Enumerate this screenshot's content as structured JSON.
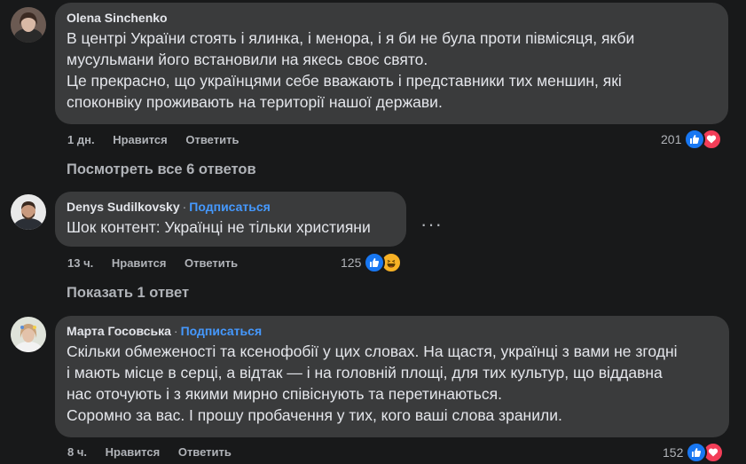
{
  "comments": [
    {
      "author": "Olena Sinchenko",
      "follow": "",
      "lines": [
        "В центрі України стоять і ялинка, і менора, і я би не була проти півмісяця, якби",
        "мусульмани його встановили на якесь своє свято.",
        "Це прекрасно, що українцями себе вважають і представники тих меншин, які",
        "споконвіку проживають на території нашої держави."
      ],
      "time": "1 дн.",
      "like_label": "Нравится",
      "reply_label": "Ответить",
      "reaction_count": "201",
      "reactions": [
        "like-icon",
        "love-icon"
      ]
    },
    {
      "author": "Denys Sudilkovsky",
      "follow": "Подписаться",
      "lines": [
        "Шок контент: Українці не тільки християни"
      ],
      "time": "13 ч.",
      "like_label": "Нравится",
      "reply_label": "Ответить",
      "reaction_count": "125",
      "reactions": [
        "like-icon",
        "haha-icon"
      ]
    },
    {
      "author": "Марта Госовська",
      "follow": "Подписаться",
      "lines": [
        "Скільки обмеженості та ксенофобії у цих словах. На щастя, українці з вами не згодні",
        "і мають місце в серці, а відтак — і на головній площі, для тих культур, що віддавна",
        "нас оточують і з якими мирно співіснують та перетинаються.",
        "Соромно за вас. І прошу пробачення у тих, кого ваші слова зранили."
      ],
      "time": "8 ч.",
      "like_label": "Нравится",
      "reply_label": "Ответить",
      "reaction_count": "152",
      "reactions": [
        "like-icon",
        "love-icon"
      ]
    }
  ],
  "view_replies_1": "Посмотреть все 6 ответов",
  "view_replies_2": "Показать 1 ответ",
  "more_options": "···",
  "colors": {
    "background": "#18191a",
    "bubble": "#3a3b3c",
    "link": "#4599ff",
    "like": "#1877f2",
    "love": "#f33e58",
    "haha": "#f7b125"
  }
}
